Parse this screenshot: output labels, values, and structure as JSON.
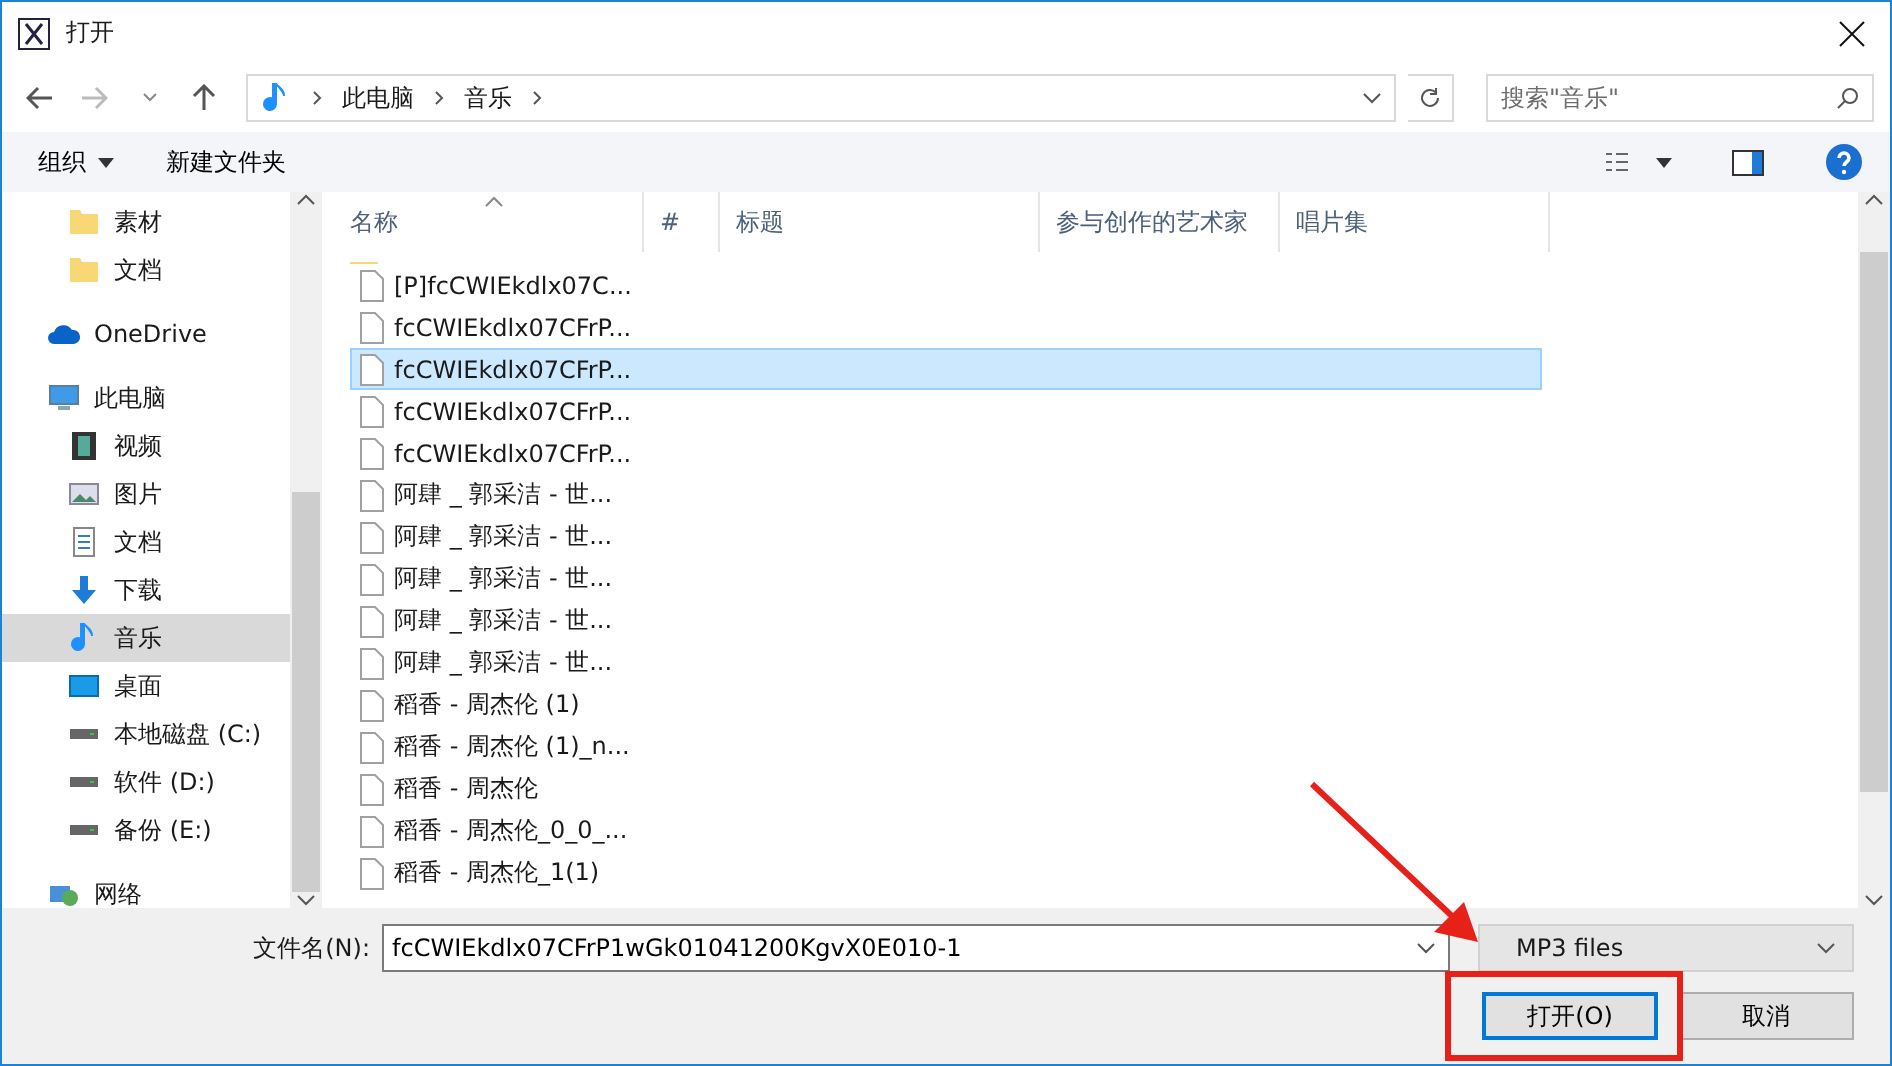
{
  "window": {
    "title": "打开"
  },
  "address": {
    "crumbs": [
      "此电脑",
      "音乐"
    ]
  },
  "search": {
    "placeholder": "搜索\"音乐\""
  },
  "toolbar": {
    "buttons": [
      "组织",
      "新建文件夹"
    ]
  },
  "sidebar": {
    "sections": [
      {
        "children": [
          {
            "label": "素材",
            "kind": "folder",
            "selected": false
          },
          {
            "label": "文档",
            "kind": "folder",
            "selected": false
          }
        ]
      },
      {
        "label": "OneDrive",
        "kind": "cloud",
        "selected": false
      },
      {
        "label": "此电脑",
        "kind": "pc",
        "selected": false,
        "children": [
          {
            "label": "视频",
            "kind": "video",
            "selected": false
          },
          {
            "label": "图片",
            "kind": "picture",
            "selected": false
          },
          {
            "label": "文档",
            "kind": "document",
            "selected": false
          },
          {
            "label": "下载",
            "kind": "download",
            "selected": false
          },
          {
            "label": "音乐",
            "kind": "music",
            "selected": true
          },
          {
            "label": "桌面",
            "kind": "desktop",
            "selected": false
          },
          {
            "label": "本地磁盘 (C:)",
            "kind": "drive",
            "selected": false
          },
          {
            "label": "软件 (D:)",
            "kind": "drive",
            "selected": false
          },
          {
            "label": "备份 (E:)",
            "kind": "drive",
            "selected": false
          }
        ]
      },
      {
        "label": "网络",
        "kind": "network",
        "selected": false
      }
    ]
  },
  "table": {
    "columns": [
      "名称",
      "#",
      "标题",
      "参与创作的艺术家",
      "唱片集"
    ],
    "rows": [
      {
        "name": "[P]fcCWIEkdlx07C...",
        "selected": false
      },
      {
        "name": "fcCWIEkdlx07CFrP...",
        "selected": false
      },
      {
        "name": "fcCWIEkdlx07CFrP...",
        "selected": true
      },
      {
        "name": "fcCWIEkdlx07CFrP...",
        "selected": false
      },
      {
        "name": "fcCWIEkdlx07CFrP...",
        "selected": false
      },
      {
        "name": "阿肆 _ 郭采洁 - 世...",
        "selected": false
      },
      {
        "name": "阿肆 _ 郭采洁 - 世...",
        "selected": false
      },
      {
        "name": "阿肆 _ 郭采洁 - 世...",
        "selected": false
      },
      {
        "name": "阿肆 _ 郭采洁 - 世...",
        "selected": false
      },
      {
        "name": "阿肆 _ 郭采洁 - 世...",
        "selected": false
      },
      {
        "name": "稻香 - 周杰伦 (1)",
        "selected": false
      },
      {
        "name": "稻香 - 周杰伦 (1)_n...",
        "selected": false
      },
      {
        "name": "稻香 - 周杰伦",
        "selected": false
      },
      {
        "name": "稻香 - 周杰伦_0_0_...",
        "selected": false
      },
      {
        "name": "稻香 - 周杰伦_1(1)",
        "selected": false
      }
    ]
  },
  "filename": {
    "label": "文件名(N):",
    "value": "fcCWIEkdlx07CFrP1wGk01041200KgvX0E010-1"
  },
  "filetype": {
    "value": "MP3 files"
  },
  "buttons": [
    {
      "label": "打开(O)",
      "primary": true
    },
    {
      "label": "取消",
      "primary": false
    }
  ]
}
